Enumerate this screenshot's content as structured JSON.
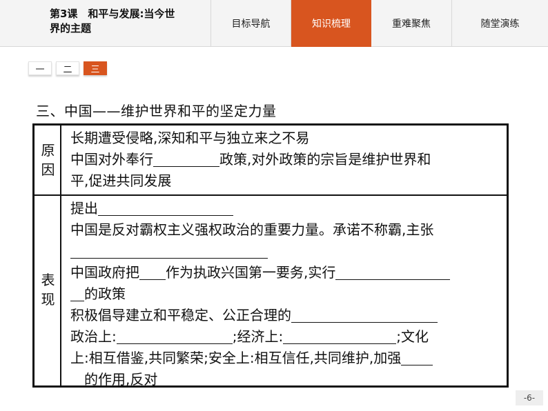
{
  "header": {
    "lesson_title_line1": "第3课　和平与发展:当今世",
    "lesson_title_line2": "界的主题",
    "tabs": [
      {
        "label": "目标导航",
        "active": false
      },
      {
        "label": "知识梳理",
        "active": true
      },
      {
        "label": "重难聚焦",
        "active": false
      },
      {
        "label": "随堂演练",
        "active": false
      }
    ]
  },
  "subtabs": [
    {
      "label": "一",
      "active": false
    },
    {
      "label": "二",
      "active": false
    },
    {
      "label": "三",
      "active": true
    }
  ],
  "section_heading": "三、中国——维护世界和平的坚定力量",
  "table": {
    "reason_label": "原因",
    "reason_lines": {
      "l1": "长期遭受侵略,深知和平与独立来之不易",
      "l2a": "中国对外奉行",
      "l2b": "政策,对外政策的宗旨是维护世界和",
      "l3": "平,促进共同发展"
    },
    "performance_label": "表现",
    "performance_lines": {
      "l1": "提出",
      "l2": "中国是反对霸权主义强权政治的重要力量。承诺不称霸,主张",
      "l4a": "中国政府把",
      "l4b": "作为执政兴国第一要务,实行",
      "l5": "的政策",
      "l6": "积极倡导建立和平稳定、公正合理的",
      "l7a": "政治上:",
      "l7b": ";经济上:",
      "l7c": ";文化",
      "l8": "上:相互借鉴,共同繁荣;安全上:相互信任,共同维护,加强",
      "l9a": "的作用,反对"
    }
  },
  "page_number": "-6-",
  "colors": {
    "accent": "#d8551f",
    "topbar_bg": "#f4f4f4"
  }
}
